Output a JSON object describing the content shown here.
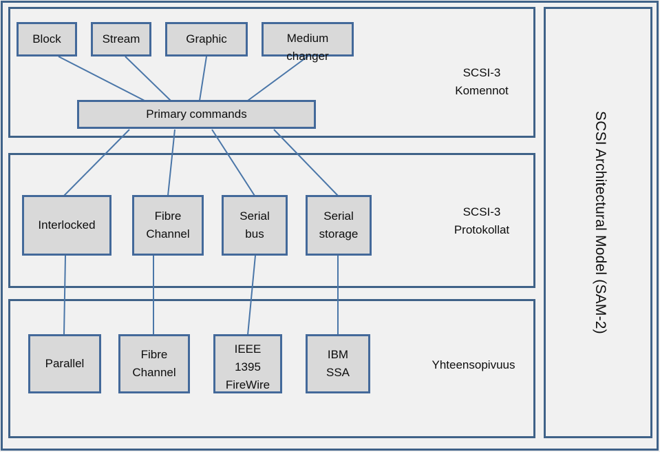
{
  "title": {
    "vertical": "SCSI Architectural Model (SAM-2)"
  },
  "layers": [
    {
      "id": "commands",
      "caption": "SCSI-3\nKomennot",
      "device_nodes": [
        {
          "label": "Block"
        },
        {
          "label": "Stream"
        },
        {
          "label": "Graphic"
        },
        {
          "label": "Medium\nchanger"
        }
      ],
      "common_node": {
        "label": "Primary commands"
      }
    },
    {
      "id": "protocols",
      "caption": "SCSI-3\nProtokollat",
      "nodes": [
        {
          "label": "Interlocked"
        },
        {
          "label": "Fibre\nChannel"
        },
        {
          "label": "Serial\nbus"
        },
        {
          "label": "Serial\nstorage"
        }
      ]
    },
    {
      "id": "interconnects",
      "caption": "Yhteensopivuus",
      "nodes": [
        {
          "label": "Parallel"
        },
        {
          "label": "Fibre\nChannel"
        },
        {
          "label": "IEEE\n1395\nFireWire"
        },
        {
          "label": "IBM\nSSA"
        }
      ]
    }
  ],
  "colors": {
    "box_fill": "#d9d9d9",
    "box_border": "#43699a",
    "panel_border": "#3f6288",
    "background": "#f1f1f1",
    "connector": "#4a76a8",
    "text": "#0d0d0d"
  }
}
